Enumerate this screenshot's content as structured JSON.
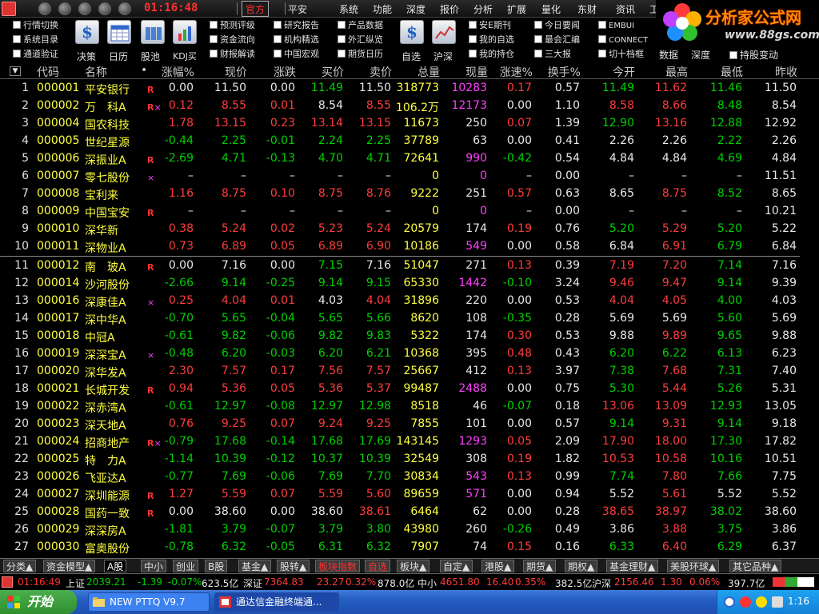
{
  "topbar": {
    "clock": "01:16:48",
    "tabs": [
      {
        "label": "官方"
      },
      {
        "label": "平安"
      }
    ],
    "menu": [
      "系统",
      "功能",
      "深度",
      "报价",
      "分析",
      "扩展",
      "量化",
      "东财",
      "资讯",
      "工"
    ]
  },
  "toolbar": {
    "col1": [
      "行情切换",
      "系统目录",
      "通道验证"
    ],
    "big": [
      {
        "label": "决策",
        "icon": "dollar-icon"
      },
      {
        "label": "日历",
        "icon": "calendar-icon"
      },
      {
        "label": "股池",
        "icon": "stock-pool-icon"
      },
      {
        "label": "KDJ买",
        "icon": "kdj-chart-icon"
      }
    ],
    "col2": [
      "预测评级",
      "资金流向",
      "财报解读"
    ],
    "col3": [
      "研究报告",
      "机构精选",
      "中国宏观"
    ],
    "col4": [
      "产品数据",
      "外汇纵览",
      "期货日历"
    ],
    "big2": [
      {
        "label": "自选",
        "icon": "dollar-icon"
      },
      {
        "label": "沪深",
        "icon": "line-chart-icon"
      }
    ],
    "col5": [
      "安E期刊",
      "我的自选",
      "我的持仓"
    ],
    "col6": [
      "今日要闻",
      "最会汇编",
      "三大报"
    ],
    "col7": [
      "EMBUI",
      "CONNECT",
      "切十档框"
    ],
    "sub": [
      "数据",
      "深度",
      "持股变动"
    ]
  },
  "brand": {
    "name": "分析家公式网",
    "url": "www.88gs.com"
  },
  "table": {
    "headers": [
      "代码",
      "名称",
      "•",
      "涨幅%",
      "现价",
      "涨跌",
      "买价",
      "卖价",
      "总量",
      "现量",
      "涨速%",
      "换手%",
      "今开",
      "最高",
      "最低",
      "昨收"
    ],
    "scroll_glyph": "▼",
    "rows": [
      {
        "i": "1",
        "code": "000001",
        "name": "平安银行",
        "flag": "R",
        "chg": "0.00",
        "price": "11.50",
        "diff": "0.00",
        "bid": "11.49",
        "ask": "11.50",
        "vol": "318773",
        "cur": "10283",
        "spd": "0.17",
        "turn": "0.57",
        "open": "11.49",
        "high": "11.62",
        "low": "11.46",
        "prev": "11.50"
      },
      {
        "i": "2",
        "code": "000002",
        "name": "万　科A",
        "flag": "R×",
        "chg": "0.12",
        "price": "8.55",
        "diff": "0.01",
        "bid": "8.54",
        "ask": "8.55",
        "vol": "106.2万",
        "cur": "12173",
        "spd": "0.00",
        "turn": "1.10",
        "open": "8.58",
        "high": "8.66",
        "low": "8.48",
        "prev": "8.54"
      },
      {
        "i": "3",
        "code": "000004",
        "name": "国农科技",
        "flag": "",
        "chg": "1.78",
        "price": "13.15",
        "diff": "0.23",
        "bid": "13.14",
        "ask": "13.15",
        "vol": "11673",
        "cur": "250",
        "spd": "0.07",
        "turn": "1.39",
        "open": "12.90",
        "high": "13.16",
        "low": "12.88",
        "prev": "12.92"
      },
      {
        "i": "4",
        "code": "000005",
        "name": "世纪星源",
        "flag": "",
        "chg": "-0.44",
        "price": "2.25",
        "diff": "-0.01",
        "bid": "2.24",
        "ask": "2.25",
        "vol": "37789",
        "cur": "63",
        "spd": "0.00",
        "turn": "0.41",
        "open": "2.26",
        "high": "2.26",
        "low": "2.22",
        "prev": "2.26"
      },
      {
        "i": "5",
        "code": "000006",
        "name": "深振业A",
        "flag": "R",
        "chg": "-2.69",
        "price": "4.71",
        "diff": "-0.13",
        "bid": "4.70",
        "ask": "4.71",
        "vol": "72641",
        "cur": "990",
        "spd": "-0.42",
        "turn": "0.54",
        "open": "4.84",
        "high": "4.84",
        "low": "4.69",
        "prev": "4.84"
      },
      {
        "i": "6",
        "code": "000007",
        "name": "零七股份",
        "flag": "×",
        "chg": "–",
        "price": "–",
        "diff": "–",
        "bid": "–",
        "ask": "–",
        "vol": "0",
        "cur": "0",
        "spd": "–",
        "turn": "0.00",
        "open": "–",
        "high": "–",
        "low": "–",
        "prev": "11.51"
      },
      {
        "i": "7",
        "code": "000008",
        "name": "宝利来",
        "flag": "",
        "chg": "1.16",
        "price": "8.75",
        "diff": "0.10",
        "bid": "8.75",
        "ask": "8.76",
        "vol": "9222",
        "cur": "251",
        "spd": "0.57",
        "turn": "0.63",
        "open": "8.65",
        "high": "8.75",
        "low": "8.52",
        "prev": "8.65"
      },
      {
        "i": "8",
        "code": "000009",
        "name": "中国宝安",
        "flag": "R",
        "chg": "–",
        "price": "–",
        "diff": "–",
        "bid": "–",
        "ask": "–",
        "vol": "0",
        "cur": "0",
        "spd": "–",
        "turn": "0.00",
        "open": "–",
        "high": "–",
        "low": "–",
        "prev": "10.21"
      },
      {
        "i": "9",
        "code": "000010",
        "name": "深华新",
        "flag": "",
        "chg": "0.38",
        "price": "5.24",
        "diff": "0.02",
        "bid": "5.23",
        "ask": "5.24",
        "vol": "20579",
        "cur": "174",
        "spd": "0.19",
        "turn": "0.76",
        "open": "5.20",
        "high": "5.29",
        "low": "5.20",
        "prev": "5.22"
      },
      {
        "i": "10",
        "code": "000011",
        "name": "深物业A",
        "flag": "",
        "chg": "0.73",
        "price": "6.89",
        "diff": "0.05",
        "bid": "6.89",
        "ask": "6.90",
        "vol": "10186",
        "cur": "549",
        "spd": "0.00",
        "turn": "0.58",
        "open": "6.84",
        "high": "6.91",
        "low": "6.79",
        "prev": "6.84"
      },
      {
        "i": "11",
        "code": "000012",
        "name": "南　玻A",
        "flag": "R",
        "chg": "0.00",
        "price": "7.16",
        "diff": "0.00",
        "bid": "7.15",
        "ask": "7.16",
        "vol": "51047",
        "cur": "271",
        "spd": "0.13",
        "turn": "0.39",
        "open": "7.19",
        "high": "7.20",
        "low": "7.14",
        "prev": "7.16"
      },
      {
        "i": "12",
        "code": "000014",
        "name": "沙河股份",
        "flag": "",
        "chg": "-2.66",
        "price": "9.14",
        "diff": "-0.25",
        "bid": "9.14",
        "ask": "9.15",
        "vol": "65330",
        "cur": "1442",
        "spd": "-0.10",
        "turn": "3.24",
        "open": "9.46",
        "high": "9.47",
        "low": "9.14",
        "prev": "9.39"
      },
      {
        "i": "13",
        "code": "000016",
        "name": "深康佳A",
        "flag": "×",
        "chg": "0.25",
        "price": "4.04",
        "diff": "0.01",
        "bid": "4.03",
        "ask": "4.04",
        "vol": "31896",
        "cur": "220",
        "spd": "0.00",
        "turn": "0.53",
        "open": "4.04",
        "high": "4.05",
        "low": "4.00",
        "prev": "4.03"
      },
      {
        "i": "14",
        "code": "000017",
        "name": "深中华A",
        "flag": "",
        "chg": "-0.70",
        "price": "5.65",
        "diff": "-0.04",
        "bid": "5.65",
        "ask": "5.66",
        "vol": "8620",
        "cur": "108",
        "spd": "-0.35",
        "turn": "0.28",
        "open": "5.69",
        "high": "5.69",
        "low": "5.60",
        "prev": "5.69"
      },
      {
        "i": "15",
        "code": "000018",
        "name": "中冠A",
        "flag": "",
        "chg": "-0.61",
        "price": "9.82",
        "diff": "-0.06",
        "bid": "9.82",
        "ask": "9.83",
        "vol": "5322",
        "cur": "174",
        "spd": "0.30",
        "turn": "0.53",
        "open": "9.88",
        "high": "9.89",
        "low": "9.65",
        "prev": "9.88"
      },
      {
        "i": "16",
        "code": "000019",
        "name": "深深宝A",
        "flag": "×",
        "chg": "-0.48",
        "price": "6.20",
        "diff": "-0.03",
        "bid": "6.20",
        "ask": "6.21",
        "vol": "10368",
        "cur": "395",
        "spd": "0.48",
        "turn": "0.43",
        "open": "6.20",
        "high": "6.22",
        "low": "6.13",
        "prev": "6.23"
      },
      {
        "i": "17",
        "code": "000020",
        "name": "深华发A",
        "flag": "",
        "chg": "2.30",
        "price": "7.57",
        "diff": "0.17",
        "bid": "7.56",
        "ask": "7.57",
        "vol": "25667",
        "cur": "412",
        "spd": "0.13",
        "turn": "3.97",
        "open": "7.38",
        "high": "7.68",
        "low": "7.31",
        "prev": "7.40"
      },
      {
        "i": "18",
        "code": "000021",
        "name": "长城开发",
        "flag": "R",
        "chg": "0.94",
        "price": "5.36",
        "diff": "0.05",
        "bid": "5.36",
        "ask": "5.37",
        "vol": "99487",
        "cur": "2488",
        "spd": "0.00",
        "turn": "0.75",
        "open": "5.30",
        "high": "5.44",
        "low": "5.26",
        "prev": "5.31"
      },
      {
        "i": "19",
        "code": "000022",
        "name": "深赤湾A",
        "flag": "",
        "chg": "-0.61",
        "price": "12.97",
        "diff": "-0.08",
        "bid": "12.97",
        "ask": "12.98",
        "vol": "8518",
        "cur": "46",
        "spd": "-0.07",
        "turn": "0.18",
        "open": "13.06",
        "high": "13.09",
        "low": "12.93",
        "prev": "13.05"
      },
      {
        "i": "20",
        "code": "000023",
        "name": "深天地A",
        "flag": "",
        "chg": "0.76",
        "price": "9.25",
        "diff": "0.07",
        "bid": "9.24",
        "ask": "9.25",
        "vol": "7855",
        "cur": "101",
        "spd": "0.00",
        "turn": "0.57",
        "open": "9.14",
        "high": "9.31",
        "low": "9.14",
        "prev": "9.18"
      },
      {
        "i": "21",
        "code": "000024",
        "name": "招商地产",
        "flag": "R×",
        "chg": "-0.79",
        "price": "17.68",
        "diff": "-0.14",
        "bid": "17.68",
        "ask": "17.69",
        "vol": "143145",
        "cur": "1293",
        "spd": "0.05",
        "turn": "2.09",
        "open": "17.90",
        "high": "18.00",
        "low": "17.30",
        "prev": "17.82"
      },
      {
        "i": "22",
        "code": "000025",
        "name": "特　力A",
        "flag": "",
        "chg": "-1.14",
        "price": "10.39",
        "diff": "-0.12",
        "bid": "10.37",
        "ask": "10.39",
        "vol": "32549",
        "cur": "308",
        "spd": "0.19",
        "turn": "1.82",
        "open": "10.53",
        "high": "10.58",
        "low": "10.16",
        "prev": "10.51"
      },
      {
        "i": "23",
        "code": "000026",
        "name": "飞亚达A",
        "flag": "",
        "chg": "-0.77",
        "price": "7.69",
        "diff": "-0.06",
        "bid": "7.69",
        "ask": "7.70",
        "vol": "30834",
        "cur": "543",
        "spd": "0.13",
        "turn": "0.99",
        "open": "7.74",
        "high": "7.80",
        "low": "7.66",
        "prev": "7.75"
      },
      {
        "i": "24",
        "code": "000027",
        "name": "深圳能源",
        "flag": "R",
        "chg": "1.27",
        "price": "5.59",
        "diff": "0.07",
        "bid": "5.59",
        "ask": "5.60",
        "vol": "89659",
        "cur": "571",
        "spd": "0.00",
        "turn": "0.94",
        "open": "5.52",
        "high": "5.61",
        "low": "5.52",
        "prev": "5.52"
      },
      {
        "i": "25",
        "code": "000028",
        "name": "国药一致",
        "flag": "R",
        "chg": "0.00",
        "price": "38.60",
        "diff": "0.00",
        "bid": "38.60",
        "ask": "38.61",
        "vol": "6464",
        "cur": "62",
        "spd": "0.00",
        "turn": "0.28",
        "open": "38.65",
        "high": "38.97",
        "low": "38.02",
        "prev": "38.60"
      },
      {
        "i": "26",
        "code": "000029",
        "name": "深深房A",
        "flag": "",
        "chg": "-1.81",
        "price": "3.79",
        "diff": "-0.07",
        "bid": "3.79",
        "ask": "3.80",
        "vol": "43980",
        "cur": "260",
        "spd": "-0.26",
        "turn": "0.49",
        "open": "3.86",
        "high": "3.88",
        "low": "3.75",
        "prev": "3.86"
      },
      {
        "i": "27",
        "code": "000030",
        "name": "富奥股份",
        "flag": "",
        "chg": "-0.78",
        "price": "6.32",
        "diff": "-0.05",
        "bid": "6.31",
        "ask": "6.32",
        "vol": "7907",
        "cur": "74",
        "spd": "0.15",
        "turn": "0.16",
        "open": "6.33",
        "high": "6.40",
        "low": "6.29",
        "prev": "6.37"
      }
    ]
  },
  "tabs": [
    {
      "label": "分类▲"
    },
    {
      "label": "资金模型▲"
    },
    {
      "label": "A股"
    },
    {
      "label": "中小"
    },
    {
      "label": "创业"
    },
    {
      "label": "B股"
    },
    {
      "label": "基金▲"
    },
    {
      "label": "股转▲"
    },
    {
      "label": "板块指数"
    },
    {
      "label": "自选"
    },
    {
      "label": "板块▲"
    },
    {
      "label": "自定▲"
    },
    {
      "label": "港股▲"
    },
    {
      "label": "期货▲"
    },
    {
      "label": "期权▲"
    },
    {
      "label": "基金理财▲"
    },
    {
      "label": "美股环球▲"
    },
    {
      "label": "其它品种▲"
    }
  ],
  "status": {
    "time": "01:16:49",
    "sh": {
      "name": "上证",
      "val": "2039.21",
      "chg": "-1.39",
      "pct": "-0.07%",
      "amt": "623.5亿"
    },
    "sz": {
      "name": "深证",
      "val": "7364.83",
      "chg": "23.27",
      "pct": "0.32%",
      "amt": "878.0亿"
    },
    "zx": {
      "name": "中小",
      "val": "4651.80",
      "chg": "16.40",
      "pct": "0.35%",
      "amt": "382.5亿"
    },
    "hs": {
      "name": "沪深",
      "val": "2156.46",
      "chg": "1.30",
      "pct": "0.06%",
      "amt": "397.7亿"
    }
  },
  "taskbar": {
    "start": "开始",
    "tasks": [
      {
        "label": "NEW PTTQ V9.7"
      },
      {
        "label": "通达信金融终端通..."
      }
    ],
    "time": "1:16"
  }
}
